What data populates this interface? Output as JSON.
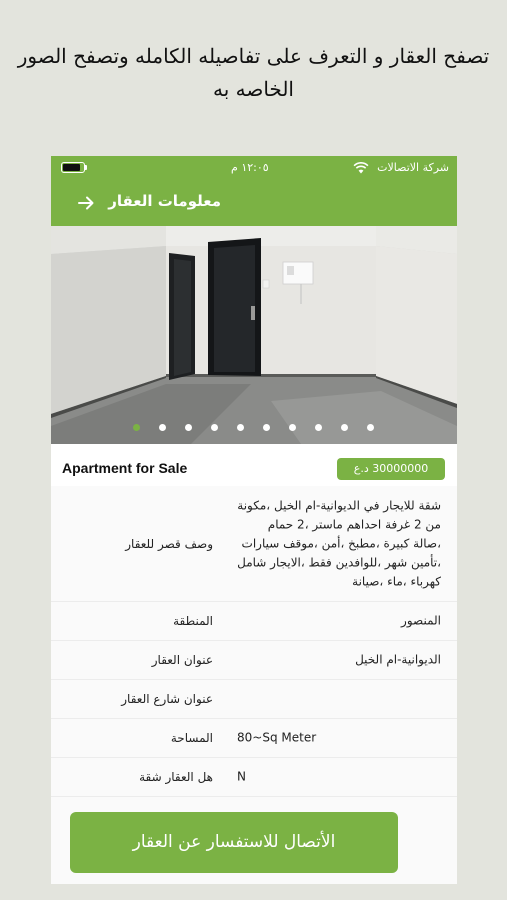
{
  "caption": "تصفح العقار و التعرف على تفاصيله الكامله وتصفح الصور الخاصه به",
  "status_bar": {
    "carrier": "شركة الاتصالات",
    "time": "١٢:٠٥ م",
    "battery_level": 0.9
  },
  "app_bar": {
    "title": "معلومات العقار",
    "back_icon": "arrow-right-icon"
  },
  "gallery": {
    "photo_count": 10,
    "active_index": 0
  },
  "listing": {
    "price": "30000000 د.ع",
    "title": "Apartment for Sale"
  },
  "details": [
    {
      "label": "وصف قصر للعقار",
      "value": "شقة للايجار في الديوانية-ام الخيل ،مكونة من 2 غرفة احداهم ماستر ،2 حمام ،صالة كبيرة ،مطبخ ،أمن ،موقف سيارات ،تأمين شهر ،للوافدين فقط ،الايجار شامل كهرباء ،ماء ،صيانة"
    },
    {
      "label": "المنطقة",
      "value": "المنصور"
    },
    {
      "label": "عنوان العقار",
      "value": "الديوانية-ام الخيل"
    },
    {
      "label": "عنوان شارع العقار",
      "value": ""
    },
    {
      "label": "المساحة",
      "value": "80~Sq Meter"
    },
    {
      "label": "هل العقار شقة",
      "value": "N"
    }
  ],
  "cta_label": "الأتصال للاستفسار عن العقار",
  "colors": {
    "accent": "#7bb244",
    "background": "#e3e4dd"
  }
}
